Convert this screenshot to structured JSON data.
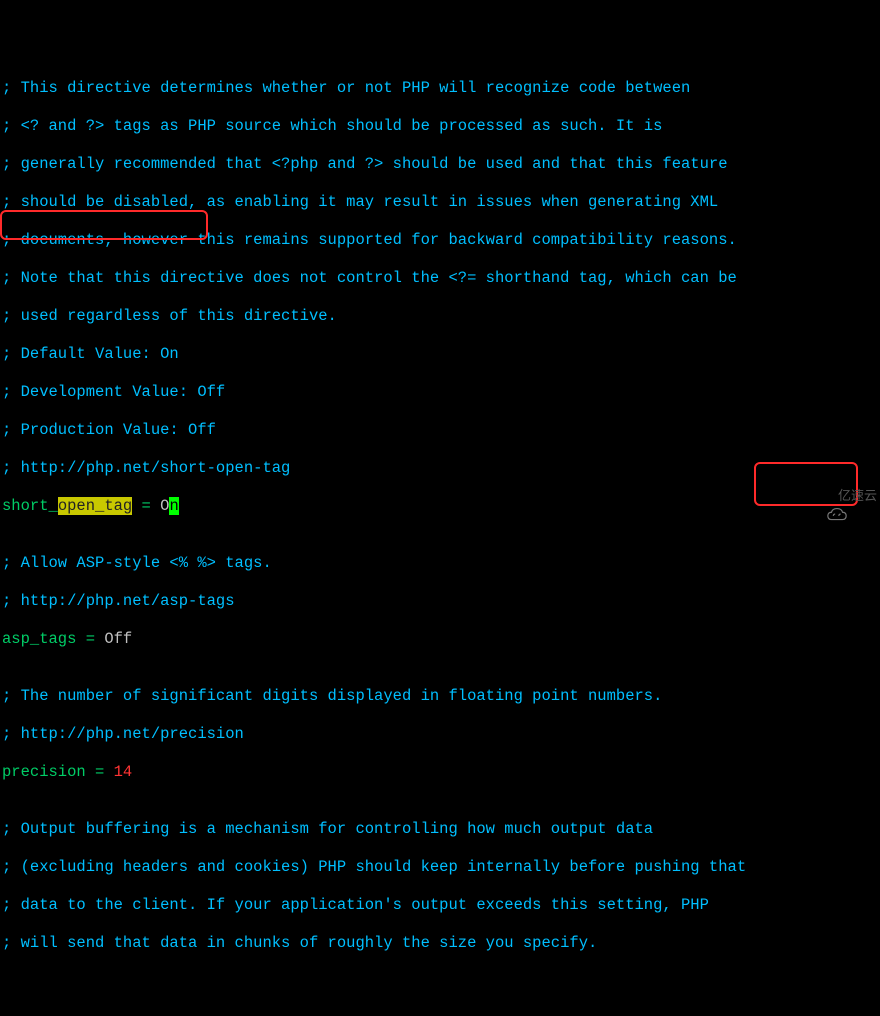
{
  "lines": {
    "c1": "; This directive determines whether or not PHP will recognize code between",
    "c2": "; <? and ?> tags as PHP source which should be processed as such. It is",
    "c3": "; generally recommended that <?php and ?> should be used and that this feature",
    "c4": "; should be disabled, as enabling it may result in issues when generating XML",
    "c5": "; documents, however this remains supported for backward compatibility reasons.",
    "c6": "; Note that this directive does not control the <?= shorthand tag, which can be",
    "c7": "; used regardless of this directive.",
    "c8": "; Default Value: On",
    "c9": "; Development Value: Off",
    "c10": "; Production Value: Off",
    "c11": "; http://php.net/short-open-tag",
    "setting1_key_prefix": "short_",
    "setting1_key_hl": "open_tag",
    "setting1_eq": " = ",
    "setting1_val_prefix": "O",
    "setting1_val_cursor": "n",
    "blank1": "",
    "c12": "; Allow ASP-style <% %> tags.",
    "c13": "; http://php.net/asp-tags",
    "setting2_key": "asp_tags",
    "setting2_eq": " = ",
    "setting2_val": "Off",
    "blank2": "",
    "c14": "; The number of significant digits displayed in floating point numbers.",
    "c15": "; http://php.net/precision",
    "setting3_key": "precision",
    "setting3_eq": " = ",
    "setting3_val": "14",
    "blank3": "",
    "c16": "; Output buffering is a mechanism for controlling how much output data",
    "c17": "; (excluding headers and cookies) PHP should keep internally before pushing that",
    "c18": "; data to the client. If your application's output exceeds this setting, PHP",
    "c19": "; will send that data in chunks of roughly the size you specify."
  },
  "watermark": {
    "text": "亿速云"
  }
}
